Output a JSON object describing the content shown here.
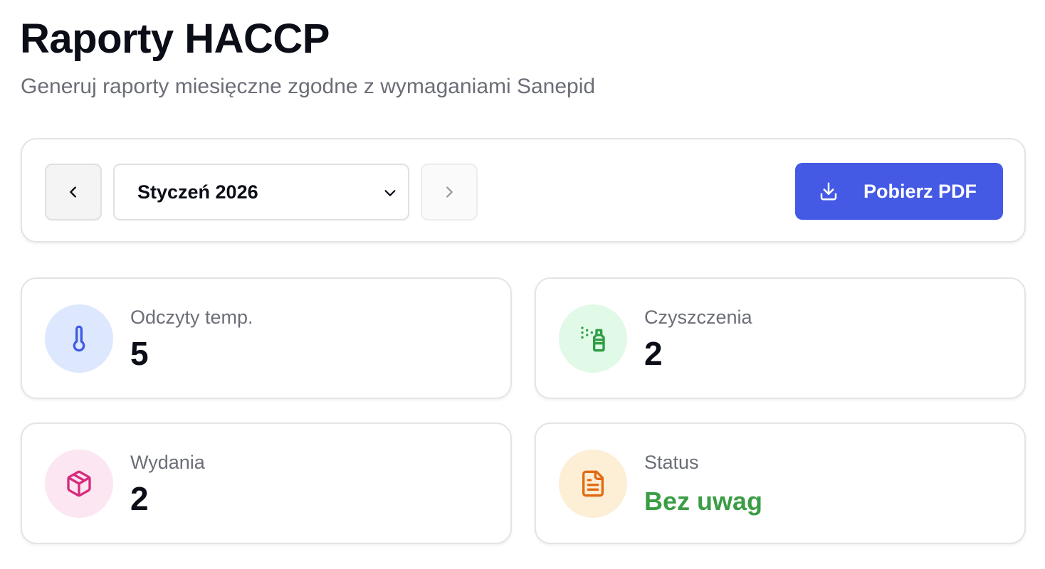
{
  "header": {
    "title": "Raporty HACCP",
    "subtitle": "Generuj raporty miesięczne zgodne z wymaganiami Sanepid"
  },
  "toolbar": {
    "prev_icon": "chevron-left-icon",
    "next_icon": "chevron-right-icon",
    "month_select": {
      "value": "Styczeń 2026",
      "icon": "chevron-down-icon"
    },
    "download_button": {
      "label": "Pobierz PDF",
      "icon": "download-icon",
      "color": "#4459e4"
    }
  },
  "stats": [
    {
      "label": "Odczyty temp.",
      "value": "5",
      "icon": "thermometer-icon",
      "icon_color": "#3f5be6",
      "bg_color": "#dde7fd"
    },
    {
      "label": "Czyszczenia",
      "value": "2",
      "icon": "spray-bottle-icon",
      "icon_color": "#2f9e46",
      "bg_color": "#e1f9e7"
    },
    {
      "label": "Wydania",
      "value": "2",
      "icon": "package-icon",
      "icon_color": "#d62b7e",
      "bg_color": "#fbe6f2"
    },
    {
      "label": "Status",
      "value": "Bez uwag",
      "icon": "document-icon",
      "icon_color": "#e26a12",
      "bg_color": "#fdeed6",
      "value_color": "#3b9d45"
    }
  ]
}
